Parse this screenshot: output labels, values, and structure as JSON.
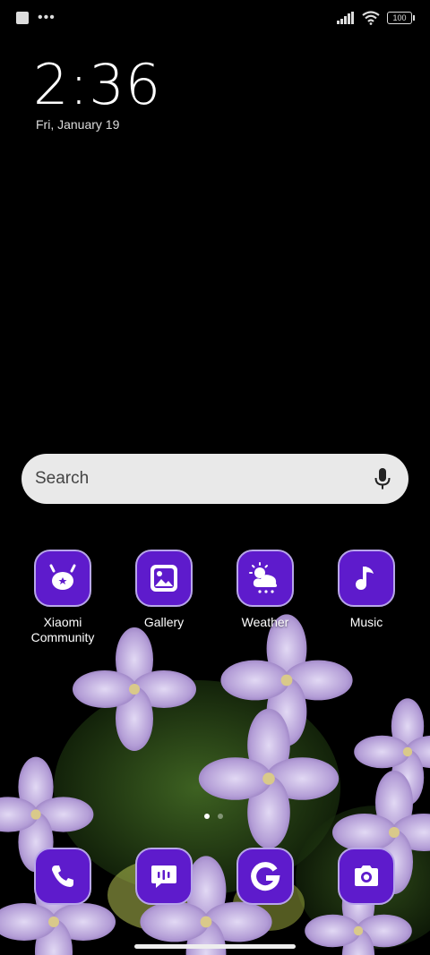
{
  "status_bar": {
    "battery": "100"
  },
  "clock": {
    "time": "2:36",
    "date": "Fri, January 19"
  },
  "search": {
    "placeholder": "Search"
  },
  "apps": [
    {
      "label": "Xiaomi Community",
      "icon": "xiaomi-community-icon"
    },
    {
      "label": "Gallery",
      "icon": "gallery-icon"
    },
    {
      "label": "Weather",
      "icon": "weather-icon"
    },
    {
      "label": "Music",
      "icon": "music-icon"
    }
  ],
  "dock": [
    {
      "icon": "phone-icon"
    },
    {
      "icon": "messages-icon"
    },
    {
      "icon": "google-icon"
    },
    {
      "icon": "camera-icon"
    }
  ],
  "colors": {
    "icon_bg": "#5e1bcc",
    "icon_border": "#b8a6e9",
    "search_bg": "#e9e9e9"
  }
}
